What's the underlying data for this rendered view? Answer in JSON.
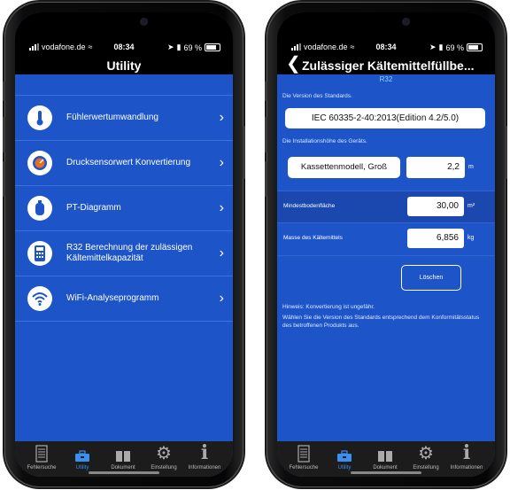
{
  "status": {
    "carrier": "vodafone.de",
    "time": "08:34",
    "battery": "69 %"
  },
  "left": {
    "title": "Utility",
    "items": [
      {
        "label": "Fühlerwertumwandlung",
        "icon": "thermometer-icon"
      },
      {
        "label": "Drucksensorwert Konvertierung",
        "icon": "pressure-gauge-icon"
      },
      {
        "label": "PT-Diagramm",
        "icon": "gas-cylinder-icon"
      },
      {
        "label": "R32 Berechnung der zulässigen Kältemittelkapazität",
        "icon": "calculator-icon"
      },
      {
        "label": "WiFi-Analyseprogramm",
        "icon": "wifi-icon"
      }
    ]
  },
  "right": {
    "title": "Zulässiger Kältemittelfüllbe...",
    "subtitle": "R32",
    "standard_caption": "Die Version des Standards.",
    "standard_value": "IEC 60335-2-40:2013(Edition 4.2/5.0)",
    "height_caption": "Die Installationshöhe des Geräts.",
    "model_value": "Kassettenmodell, Groß",
    "height_value": "2,2",
    "height_unit": "m",
    "floor_label": "Mindestbodenfläche",
    "floor_value": "30,00",
    "floor_unit": "m²",
    "mass_label": "Masse des Kältemittels",
    "mass_value": "6,856",
    "mass_unit": "kg",
    "clear_button": "Löschen",
    "hint1": "Hinweis: Konvertierung ist ungefähr.",
    "hint2": "Wählen Sie die Version des Standards entsprechend dem Konformitätsstatus des betroffenen Produkts aus."
  },
  "tabs": [
    {
      "label": "Fehlersuche",
      "icon": "document-list-icon",
      "active": false
    },
    {
      "label": "Utility",
      "icon": "toolbox-icon",
      "active": true
    },
    {
      "label": "Dokument",
      "icon": "book-icon",
      "active": false
    },
    {
      "label": "Einstellung",
      "icon": "gear-icon",
      "active": false
    },
    {
      "label": "Informationen",
      "icon": "info-icon",
      "active": false
    }
  ],
  "colors": {
    "accent": "#1d55c9",
    "tab_active": "#3a8ff0"
  }
}
